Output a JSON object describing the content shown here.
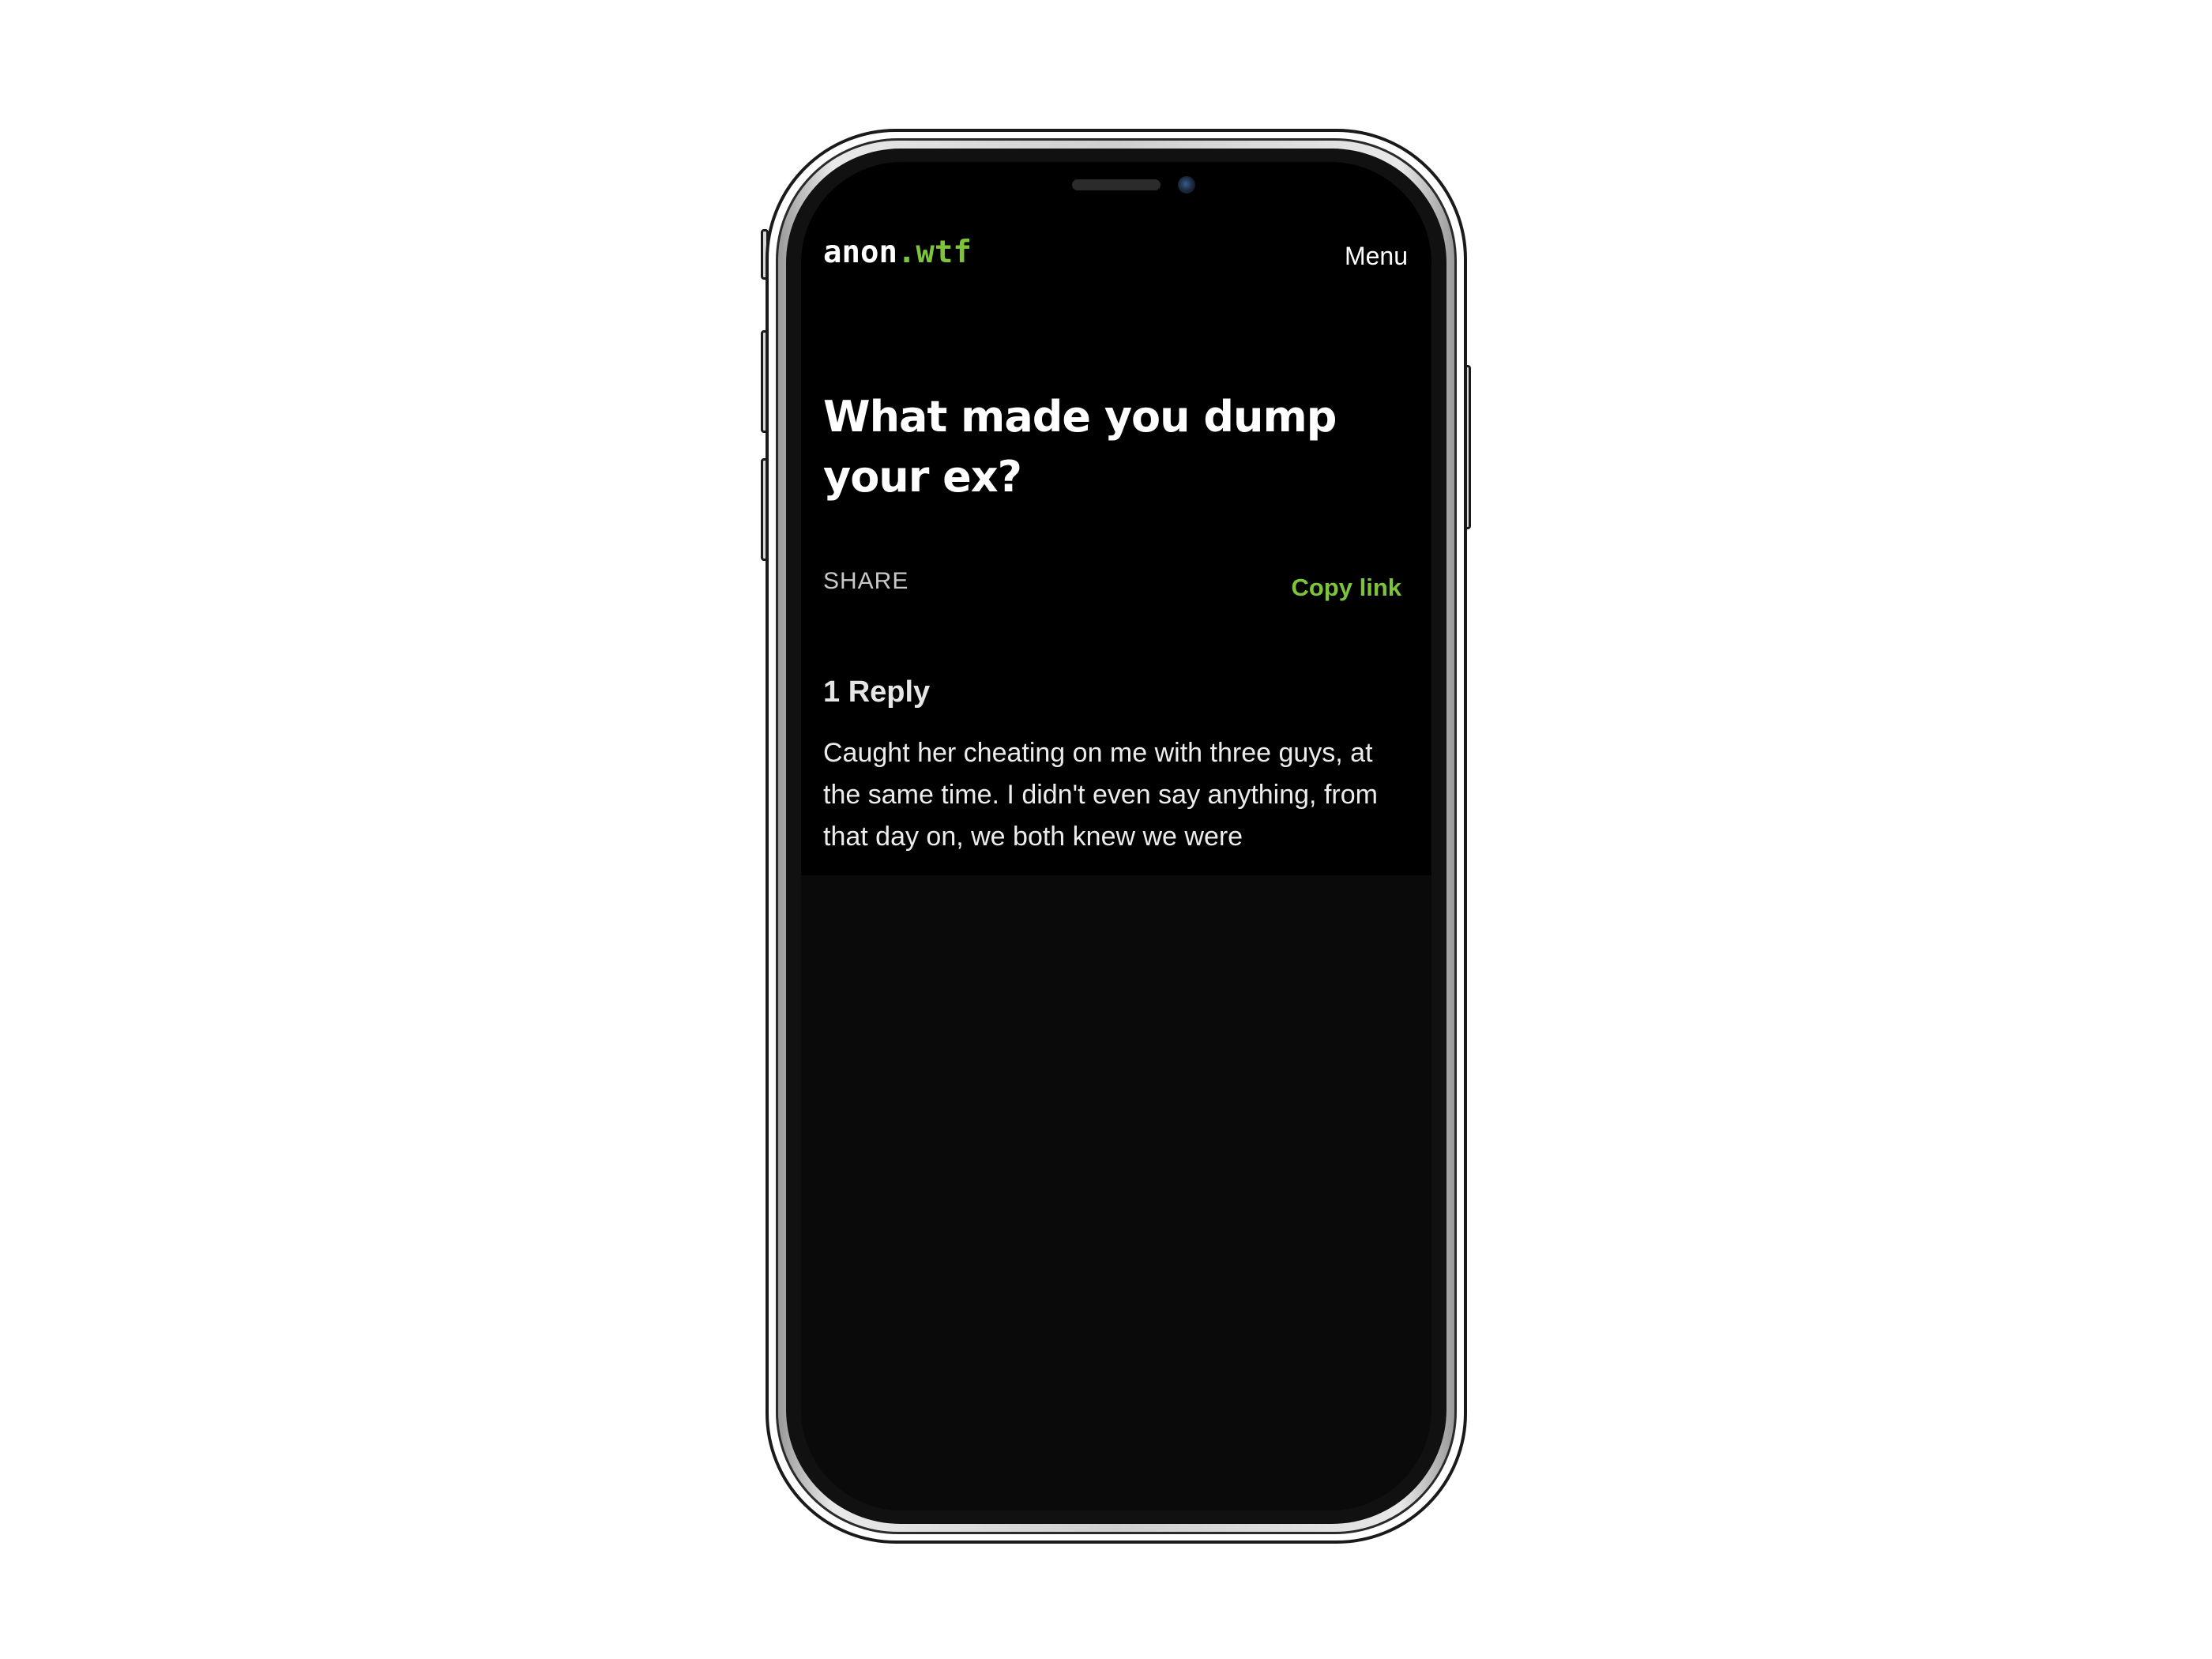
{
  "site": {
    "logo_name": "anon",
    "logo_tld": ".wtf",
    "menu_label": "Menu"
  },
  "post": {
    "title": "What made you dump your ex?",
    "share_label": "SHARE",
    "copy_link_label": "Copy link"
  },
  "replies": {
    "count_label": "1 Reply",
    "items": [
      {
        "text": "Caught her cheating on me with three guys, at the same time. I didn't even say anything, from that day on, we both knew we were"
      }
    ]
  },
  "colors": {
    "accent": "#7ec43a",
    "background": "#000000",
    "text": "#ffffff"
  }
}
